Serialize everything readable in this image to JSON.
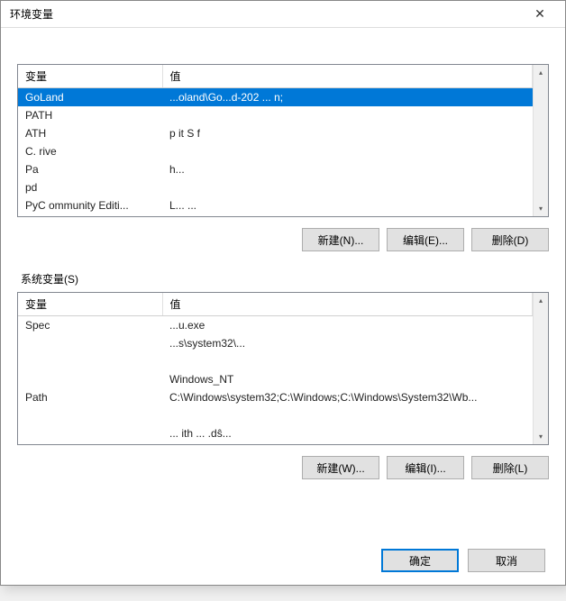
{
  "window": {
    "title": "环境变量",
    "close_icon": "✕"
  },
  "user_section": {
    "label": "",
    "headers": {
      "var": "变量",
      "val": "值"
    },
    "rows": [
      {
        "var": "GoLand",
        "val": "...oland\\Go...d-202 ...    n;",
        "selected": true
      },
      {
        "var": "   PATH",
        "val": " "
      },
      {
        "var": "         ATH",
        "val": "        p                       it S f "
      },
      {
        "var": "C.     rive",
        "val": " "
      },
      {
        "var": "Pa",
        "val": "                                                                    h..."
      },
      {
        "var": "pd",
        "val": " "
      },
      {
        "var": "PyC      ommunity Editi...",
        "val": "L...                                                        ..."
      }
    ],
    "buttons": {
      "new": "新建(N)...",
      "edit": "编辑(E)...",
      "del": "删除(D)"
    }
  },
  "system_section": {
    "label": "系统变量(S)",
    "headers": {
      "var": "变量",
      "val": "值"
    },
    "rows": [
      {
        "var": "    Spec",
        "val": "                            ...u.exe"
      },
      {
        "var": " ",
        "val": "   ...s\\system32\\..."
      },
      {
        "var": " ",
        "val": " "
      },
      {
        "var": " ",
        "val": "Windows_NT"
      },
      {
        "var": "Path",
        "val": "C:\\Windows\\system32;C:\\Windows;C:\\Windows\\System32\\Wb..."
      },
      {
        "var": " ",
        "val": " "
      },
      {
        "var": " ",
        "val": "         ...  ith  ...   .dŝ..."
      }
    ],
    "buttons": {
      "new": "新建(W)...",
      "edit": "编辑(I)...",
      "del": "删除(L)"
    }
  },
  "footer": {
    "ok": "确定",
    "cancel": "取消"
  },
  "scroll": {
    "up": "▴",
    "down": "▾"
  }
}
